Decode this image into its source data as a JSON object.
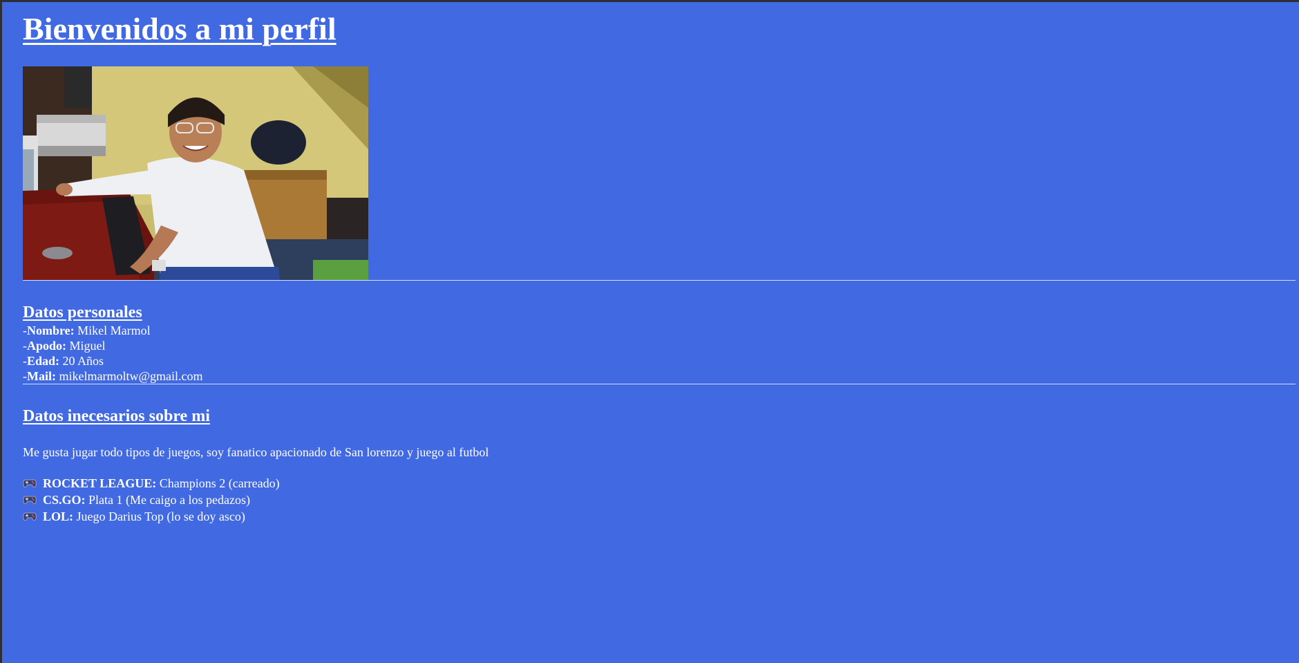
{
  "header": {
    "title": "Bienvenidos a mi perfil"
  },
  "photo": {
    "alt": "Foto de perfil"
  },
  "personal": {
    "heading": "Datos personales",
    "fields": [
      {
        "prefix": "-",
        "label": "Nombre:",
        "value": " Mikel Marmol"
      },
      {
        "prefix": "-",
        "label": "Apodo:",
        "value": " Miguel"
      },
      {
        "prefix": "-",
        "label": "Edad:",
        "value": " 20 Años"
      },
      {
        "prefix": "-",
        "label": "Mail:",
        "value": " mikelmarmoltw@gmail.com"
      }
    ]
  },
  "extra": {
    "heading": "Datos inecesarios sobre mi",
    "about": "Me gusta jugar todo tipos de juegos, soy fanatico apacionado de San lorenzo y juego al futbol",
    "games": [
      {
        "icon": "gamepad-icon",
        "name": "ROCKET LEAGUE:",
        "detail": " Champions 2 (carreado)"
      },
      {
        "icon": "gamepad-icon",
        "name": "CS.GO:",
        "detail": " Plata 1 (Me caigo a los pedazos)"
      },
      {
        "icon": "gamepad-icon",
        "name": "LOL:",
        "detail": " Juego Darius Top (lo se doy asco)"
      }
    ]
  },
  "colors": {
    "background": "#4169e1",
    "text": "#ffffff"
  }
}
